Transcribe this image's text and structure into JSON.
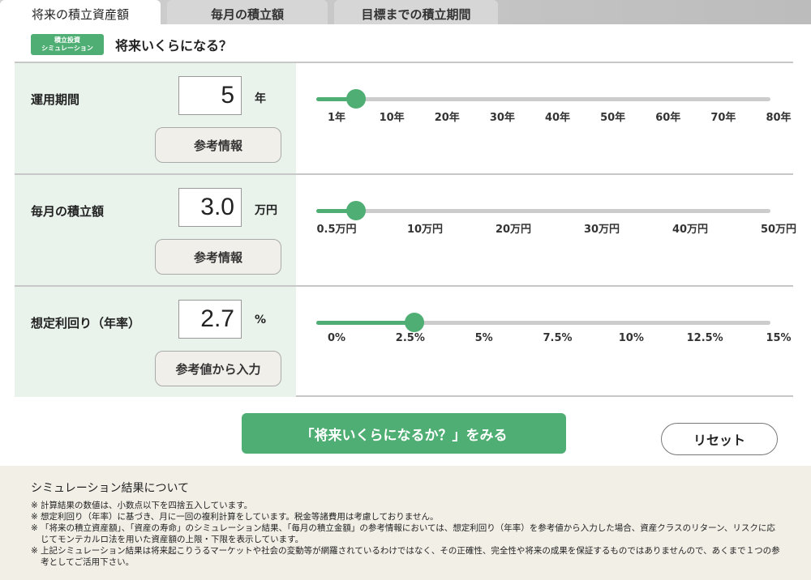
{
  "tabs": [
    {
      "label": "将来の積立資産額",
      "active": true
    },
    {
      "label": "毎月の積立額",
      "active": false
    },
    {
      "label": "目標までの積立期間",
      "active": false
    }
  ],
  "header": {
    "badge_line1": "積立投資",
    "badge_line2": "シミュレーション",
    "title": "将来いくらになる？"
  },
  "rows": [
    {
      "label": "運用期間",
      "value": "5",
      "unit": "年",
      "button": "参考情報",
      "slider_percent": 5.1,
      "ticks": [
        "1年",
        "10年",
        "20年",
        "30年",
        "40年",
        "50年",
        "60年",
        "70年",
        "80年"
      ]
    },
    {
      "label": "毎月の積立額",
      "value": "3.0",
      "unit": "万円",
      "button": "参考情報",
      "slider_percent": 5.1,
      "ticks": [
        "0.5万円",
        "10万円",
        "20万円",
        "30万円",
        "40万円",
        "50万円"
      ]
    },
    {
      "label": "想定利回り（年率）",
      "value": "2.7",
      "unit": "%",
      "button": "参考値から入力",
      "slider_percent": 18.0,
      "ticks": [
        "0%",
        "2.5%",
        "5%",
        "7.5%",
        "10%",
        "12.5%",
        "15%"
      ]
    }
  ],
  "actions": {
    "cta": "「将来いくらになるか？」をみる",
    "reset": "リセット"
  },
  "notes": {
    "title": "シミュレーション結果について",
    "mark": "※",
    "items": [
      "計算結果の数値は、小数点以下を四捨五入しています。",
      "想定利回り（年率）に基づき、月に一回の複利計算をしています。税金等諸費用は考慮しておりません。",
      "「将来の積立資産額」、「資産の寿命」のシミュレーション結果、「毎月の積立金額」の参考情報においては、想定利回り（年率）を参考値から入力した場合、資産クラスのリターン、リスクに応じてモンテカルロ法を用いた資産額の上限・下限を表示しています。",
      "上記シミュレーション結果は将来起こりうるマーケットや社会の変動等が網羅されているわけではなく、その正確性、完全性や将来の成果を保証するものではありませんので、あくまで１つの参考としてご活用下さい。"
    ]
  },
  "colors": {
    "accent": "#4fae73",
    "row_bg": "#e9f3ec",
    "notes_bg": "#f2efe7"
  }
}
